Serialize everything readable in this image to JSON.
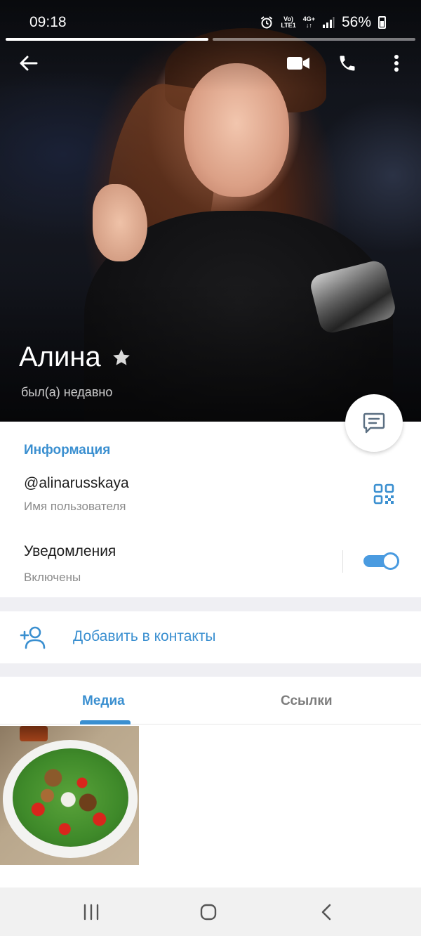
{
  "status_bar": {
    "time": "09:18",
    "network_top": "Vo)",
    "network_bottom": "LTE1",
    "network_type": "4G+",
    "battery": "56%"
  },
  "profile": {
    "name": "Алина",
    "last_seen": "был(а) недавно"
  },
  "info": {
    "section_title": "Информация",
    "username": "@alinarusskaya",
    "username_label": "Имя пользователя",
    "notifications_label": "Уведомления",
    "notifications_state": "Включены"
  },
  "actions": {
    "add_contact": "Добавить в контакты"
  },
  "tabs": {
    "media": "Медиа",
    "links": "Ссылки"
  },
  "colors": {
    "accent": "#3a8fd0",
    "toggle": "#4a9be0"
  }
}
